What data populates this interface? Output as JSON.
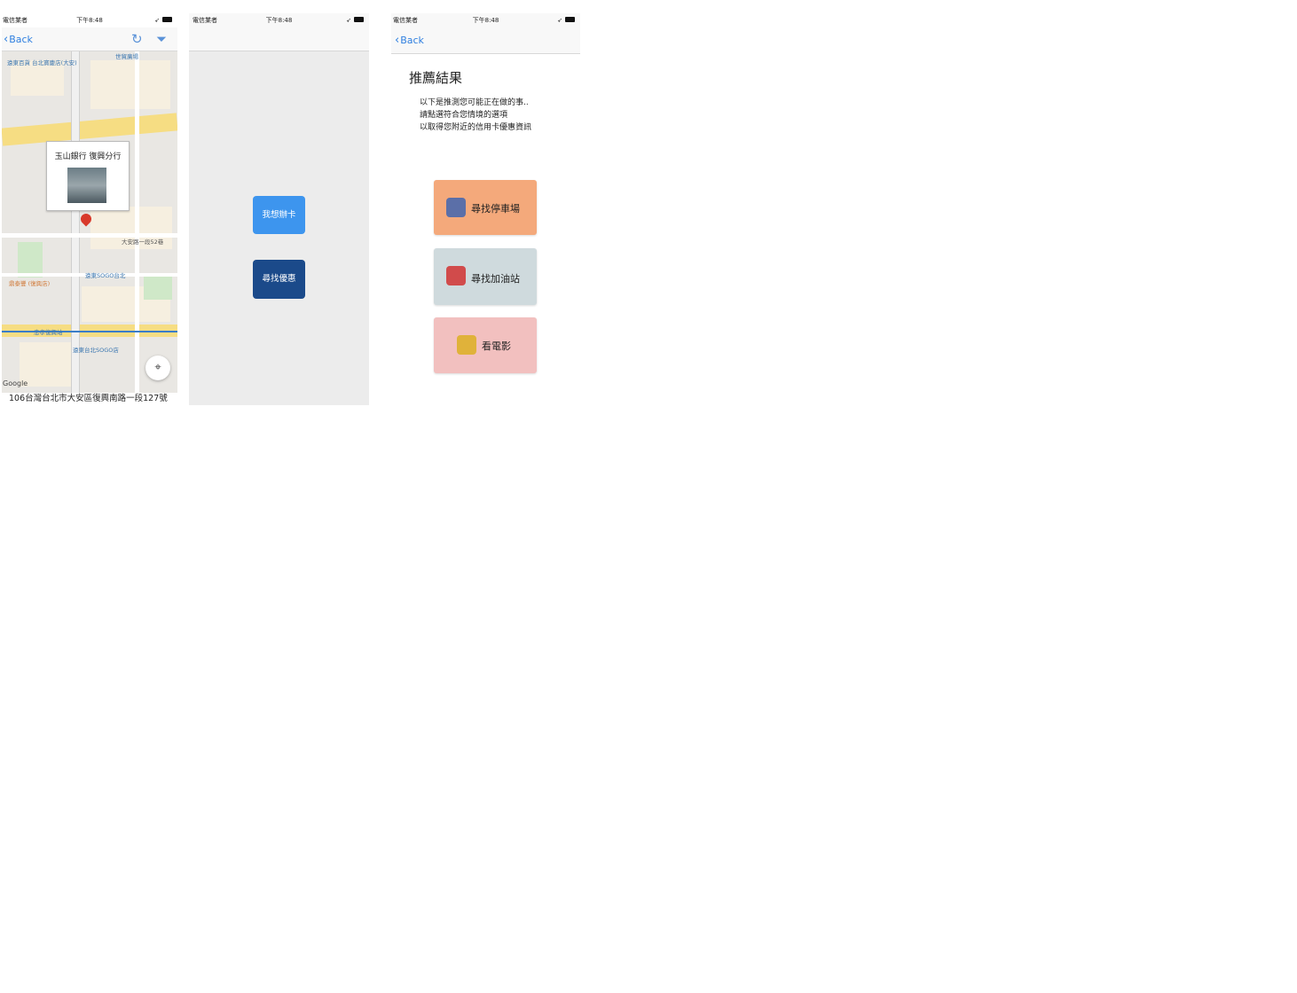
{
  "screens": {
    "map": {
      "status": {
        "carrier": "電信業者",
        "time": "下午8:48"
      },
      "back_label": "Back",
      "map_labels": {
        "top_left": "遠東百貨 台北寶慶店(大安)",
        "top_right": "世貿廣場",
        "bus": "大安路一段52巷",
        "sogo": "遠東SOGO台北",
        "restaurant": "鼎泰豐 (復興店)",
        "station": "忠孝復興站",
        "sogo2": "遠東台北SOGO店"
      },
      "callout_title": "玉山銀行 復興分行",
      "google_label": "Google",
      "address": "106台灣台北市大安區復興南路一段127號"
    },
    "menu": {
      "status": {
        "carrier": "電信業者",
        "time": "下午8:48"
      },
      "new_card_label": "我想辦卡",
      "find_offer_label": "尋找優惠"
    },
    "recommend": {
      "status": {
        "carrier": "電信業者",
        "time": "下午8:48"
      },
      "back_label": "Back",
      "title": "推薦結果",
      "desc_line1": "以下是推測您可能正在做的事..",
      "desc_line2": "請點選符合您情境的選項",
      "desc_line3": "以取得您附近的信用卡優惠資訊",
      "options": [
        {
          "label": "尋找停車場",
          "icon": "parking-icon",
          "color": "#f4a97b"
        },
        {
          "label": "尋找加油站",
          "icon": "gas-station-icon",
          "color": "#cfdadd"
        },
        {
          "label": "看電影",
          "icon": "movie-ticket-icon",
          "color": "#f2c0bf"
        }
      ]
    }
  },
  "colors": {
    "ios_blue": "#2f7fe0",
    "new_card_button": "#3d95ee",
    "find_offer_button": "#1b4a8a"
  }
}
